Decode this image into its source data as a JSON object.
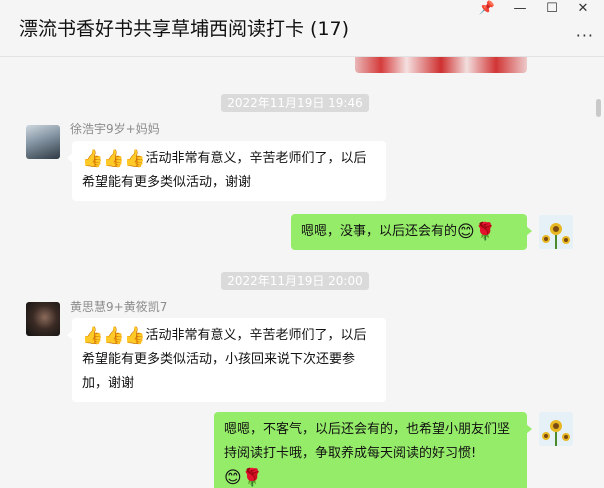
{
  "window": {
    "title": "漂流书香好书共享草埔西阅读打卡 (17)",
    "pin_icon": "📌",
    "minimize": "—",
    "maximize": "☐",
    "close": "✕",
    "more": "···"
  },
  "messages": [
    {
      "type": "time",
      "text": "2022年11月19日 19:46"
    },
    {
      "type": "left",
      "sender": "徐浩宇9岁+妈妈",
      "emoji": "👍👍👍",
      "text": "活动非常有意义，辛苦老师们了，以后希望能有更多类似活动，谢谢"
    },
    {
      "type": "right",
      "text": "嗯嗯，没事，以后还会有的",
      "emoji": "😊🌹"
    },
    {
      "type": "time",
      "text": "2022年11月19日 20:00"
    },
    {
      "type": "left",
      "sender": "黄思慧9+黄筱凯7",
      "emoji": "👍👍👍",
      "text": "活动非常有意义，辛苦老师们了，以后希望能有更多类似活动，小孩回来说下次还要参加，谢谢"
    },
    {
      "type": "right",
      "text": "嗯嗯，不客气，以后还会有的，也希望小朋友们坚持阅读打卡哦，争取养成每天阅读的好习惯!",
      "emoji": "😊🌹"
    }
  ]
}
